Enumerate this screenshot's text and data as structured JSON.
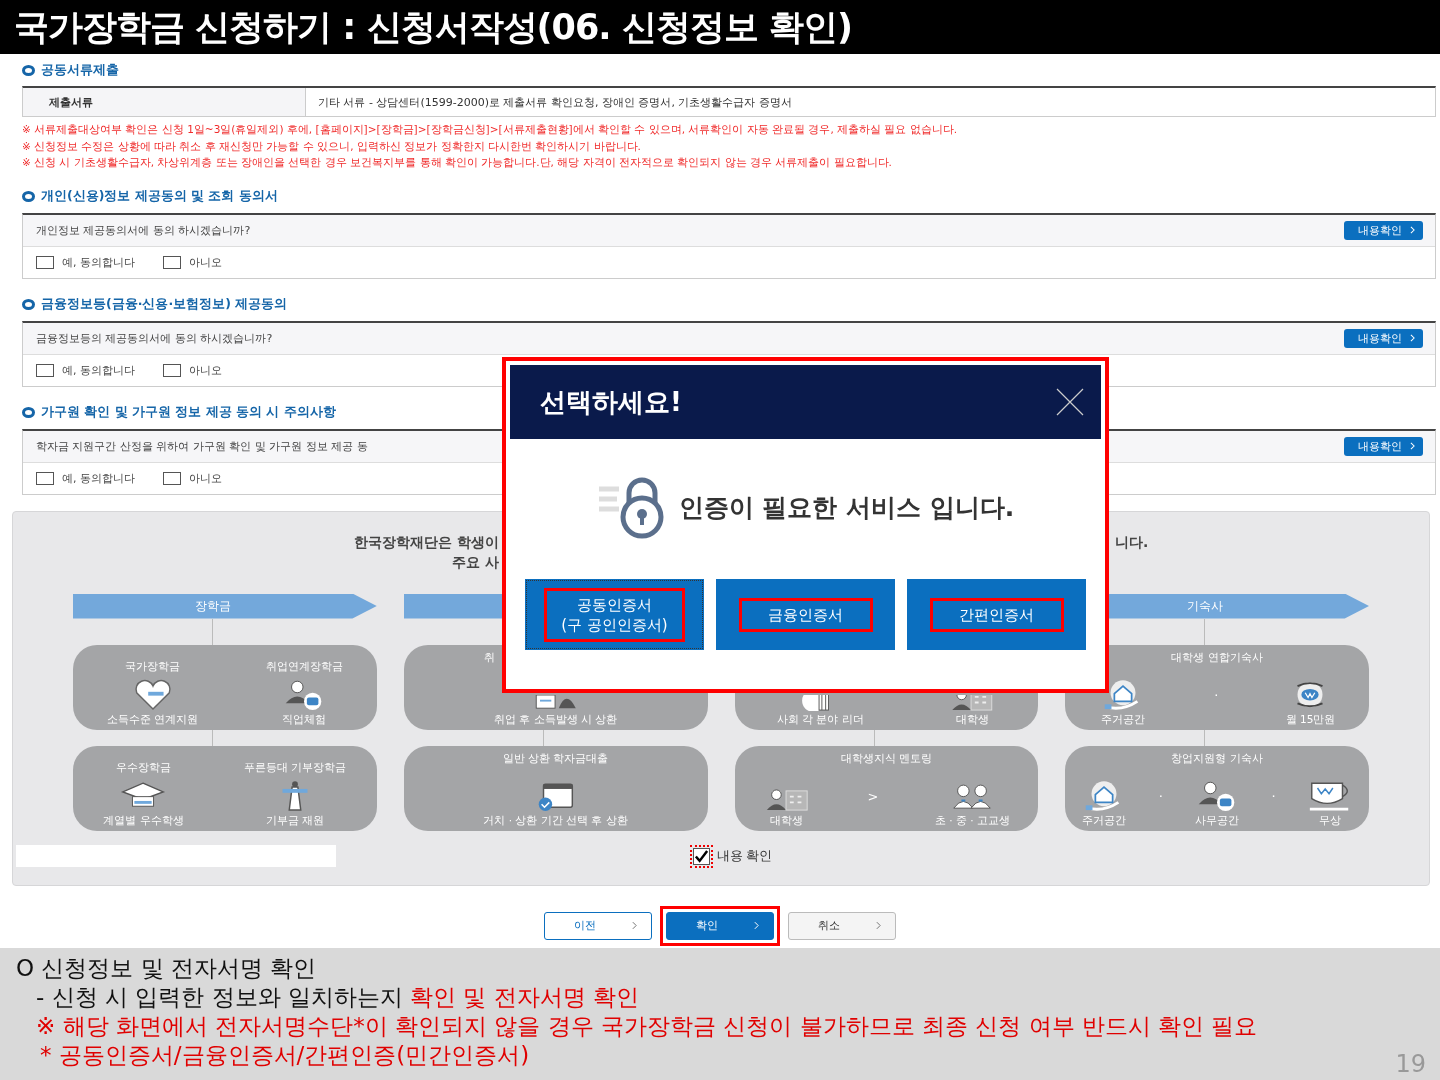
{
  "slide": {
    "title": "국가장학금 신청하기 : 신청서작성(06. 신청정보 확인)",
    "page_number": "19"
  },
  "form": {
    "sections": [
      {
        "kind": "documents",
        "title": "공동서류제출",
        "label": "제출서류",
        "value": "기타 서류 - 상담센터(1599-2000)로 제출서류 확인요청, 장애인 증명서, 기초생활수급자 증명서",
        "notes": [
          "※ 서류제출대상여부 확인은 신청 1일~3일(휴일제외) 후에, [홈페이지]>[장학금]>[장학금신청]>[서류제출현황]에서 확인할 수 있으며, 서류확인이 자동 완료될 경우, 제출하실 필요 없습니다.",
          "※ 신청정보 수정은 상황에 따라 취소 후 재신청만 가능할 수 있으니, 입력하신 정보가 정확한지 다시한번 확인하시기 바랍니다.",
          "※ 신청 시 기초생활수급자, 차상위계층 또는 장애인을 선택한 경우 보건복지부를 통해 확인이 가능합니다.단, 해당 자격이 전자적으로 확인되지 않는 경우 서류제출이 필요합니다."
        ]
      },
      {
        "kind": "consent",
        "title": "개인(신용)정보 제공동의 및 조회 동의서",
        "question": "개인정보 제공동의서에 동의 하시겠습니까?",
        "button": "내용확인",
        "options": [
          {
            "label": "예, 동의합니다",
            "checked": false
          },
          {
            "label": "아니오",
            "checked": false
          }
        ]
      },
      {
        "kind": "consent",
        "title": "금융정보등(금융·신용·보험정보) 제공동의",
        "question": "금융정보등의 제공동의서에 동의 하시겠습니까?",
        "button": "내용확인",
        "options": [
          {
            "label": "예, 동의합니다",
            "checked": false
          },
          {
            "label": "아니오",
            "checked": false
          }
        ]
      },
      {
        "kind": "consent",
        "title": "가구원 확인 및 가구원 정보 제공 동의 시 주의사항",
        "question": "학자금 지원구간 산정을 위하여 가구원 확인 및 가구원 정보 제공 동",
        "button": "내용확인",
        "options": [
          {
            "label": "예, 동의합니다",
            "checked": false
          },
          {
            "label": "아니오",
            "checked": false
          }
        ]
      }
    ],
    "info_panel": {
      "heading_left": "한국장학재단은 학생이",
      "heading_right": "니다.",
      "subheading": "주요 사",
      "columns": [
        {
          "label": "장학금",
          "cards": [
            {
              "items": [
                {
                  "title": "국가장학금",
                  "label": "소득수준 연계지원"
                },
                {
                  "title": "취업연계장학금",
                  "label": "직업체험"
                }
              ]
            },
            {
              "items": [
                {
                  "title": "우수장학금",
                  "label": "계열별 우수학생"
                },
                {
                  "title": "푸른등대 기부장학금",
                  "label": "기부금 재원"
                }
              ]
            }
          ]
        },
        {
          "cards": [
            {
              "title": "취",
              "items": [
                {
                  "label": "취업 후 소득발생 시 상환"
                }
              ]
            },
            {
              "title": "일반 상환 학자금대출",
              "items": [
                {
                  "label": "거치 · 상환 기간 선택 후 상환"
                }
              ]
            }
          ]
        },
        {
          "cards": [
            {
              "items": [
                {
                  "label": "사회 각 분야 리더"
                },
                {
                  "label": "대학생"
                }
              ]
            },
            {
              "title": "대학생지식 멘토링",
              "separator": ">",
              "items": [
                {
                  "label": "대학생"
                },
                {
                  "label": "초 · 중 · 고교생"
                }
              ]
            }
          ]
        },
        {
          "label": "기숙사",
          "cards": [
            {
              "title": "대학생 연합기숙사",
              "separator": "·",
              "items": [
                {
                  "label": "주거공간"
                },
                {
                  "label": "월 15만원"
                }
              ]
            },
            {
              "title": "창업지원형 기숙사",
              "separator": "·",
              "items": [
                {
                  "label": "주거공간"
                },
                {
                  "label": "사무공간"
                },
                {
                  "label": "무상"
                }
              ]
            }
          ]
        }
      ]
    },
    "confirm": {
      "label": "내용 확인",
      "checked": true,
      "highlighted": true
    },
    "buttons": [
      {
        "label": "이전",
        "kind": "secondary",
        "highlighted": false
      },
      {
        "label": "확인",
        "kind": "primary",
        "highlighted": true
      },
      {
        "label": "취소",
        "kind": "default",
        "highlighted": false
      }
    ]
  },
  "modal": {
    "title": "선택하세요!",
    "message": "인증이 필요한 서비스 입니다.",
    "highlighted": true,
    "options": [
      {
        "label": "공동인증서\n(구 공인인증서)",
        "focused": true,
        "highlighted": true
      },
      {
        "label": "금융인증서",
        "focused": false,
        "highlighted": true
      },
      {
        "label": "간편인증서",
        "focused": false,
        "highlighted": true
      }
    ]
  },
  "notes": [
    {
      "kind": "heading",
      "segments": [
        {
          "text": "O 신청정보 및 전자서명 확인",
          "emphasis": false
        }
      ]
    },
    {
      "kind": "item",
      "segments": [
        {
          "text": "- 신청 시 입력한 정보와 일치하는지 ",
          "emphasis": false
        },
        {
          "text": "확인 및 전자서명 확인",
          "emphasis": true
        }
      ]
    },
    {
      "kind": "item",
      "segments": [
        {
          "text": "※ 해당 화면에서 전자서명수단*이 확인되지 않을 경우 국가장학금 신청이 불가하므로 최종 신청 여부 반드시 확인 필요",
          "emphasis": true
        }
      ]
    },
    {
      "kind": "footnote",
      "segments": [
        {
          "text": " * 공동인증서/금융인증서/간편인증(민간인증서)",
          "emphasis": true
        }
      ]
    }
  ]
}
